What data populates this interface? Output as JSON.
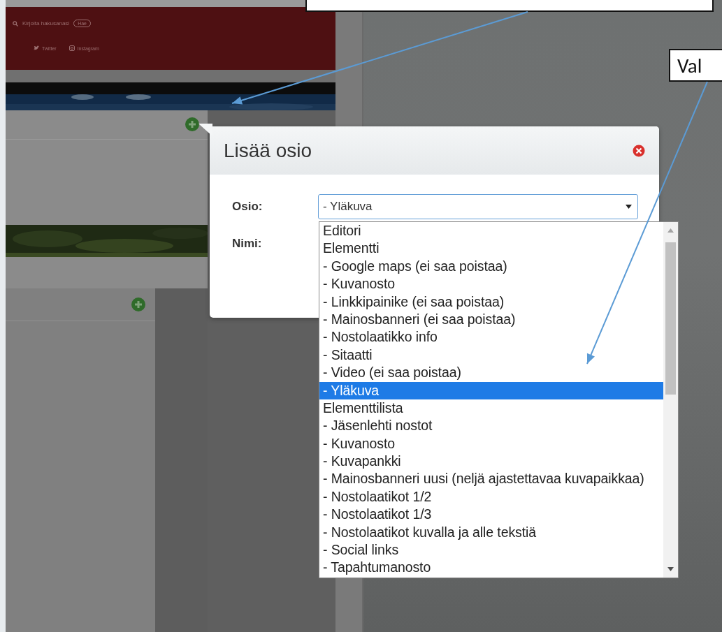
{
  "page": {
    "search": {
      "placeholder": "Kirjoita hakusanasi"
    },
    "search_button": "Hae",
    "social_links": [
      {
        "kind": "twitter",
        "label": "Twitter"
      },
      {
        "kind": "instagram",
        "label": "Instagram"
      }
    ]
  },
  "dialog": {
    "title": "Lisää osio",
    "fields": [
      {
        "kind": "select",
        "label": "Osio:",
        "value": "- Yläkuva"
      },
      {
        "kind": "text",
        "label": "Nimi:"
      }
    ]
  },
  "dropdown": {
    "options": [
      {
        "label": "Editori",
        "selected": false
      },
      {
        "label": "Elementti",
        "selected": false
      },
      {
        "label": "- Google maps (ei saa poistaa)",
        "selected": false
      },
      {
        "label": "- Kuvanosto",
        "selected": false
      },
      {
        "label": "- Linkkipainike (ei saa poistaa)",
        "selected": false
      },
      {
        "label": "- Mainosbanneri (ei saa poistaa)",
        "selected": false
      },
      {
        "label": "- Nostolaatikko info",
        "selected": false
      },
      {
        "label": "- Sitaatti",
        "selected": false
      },
      {
        "label": "- Video (ei saa poistaa)",
        "selected": false
      },
      {
        "label": "- Yläkuva",
        "selected": true
      },
      {
        "label": "Elementtilista",
        "selected": false
      },
      {
        "label": "- Jäsenlehti nostot",
        "selected": false
      },
      {
        "label": "- Kuvanosto",
        "selected": false
      },
      {
        "label": "- Kuvapankki",
        "selected": false
      },
      {
        "label": "- Mainosbanneri uusi (neljä ajastettavaa kuvapaikkaa)",
        "selected": false
      },
      {
        "label": "- Nostolaatikot 1/2",
        "selected": false
      },
      {
        "label": "- Nostolaatikot 1/3",
        "selected": false
      },
      {
        "label": "- Nostolaatikot kuvalla ja alle tekstiä",
        "selected": false
      },
      {
        "label": "- Social links",
        "selected": false
      },
      {
        "label": "- Tapahtumanosto",
        "selected": false
      }
    ]
  },
  "annotations": [
    {
      "kind": "top"
    },
    {
      "kind": "right",
      "text": "Val"
    }
  ]
}
